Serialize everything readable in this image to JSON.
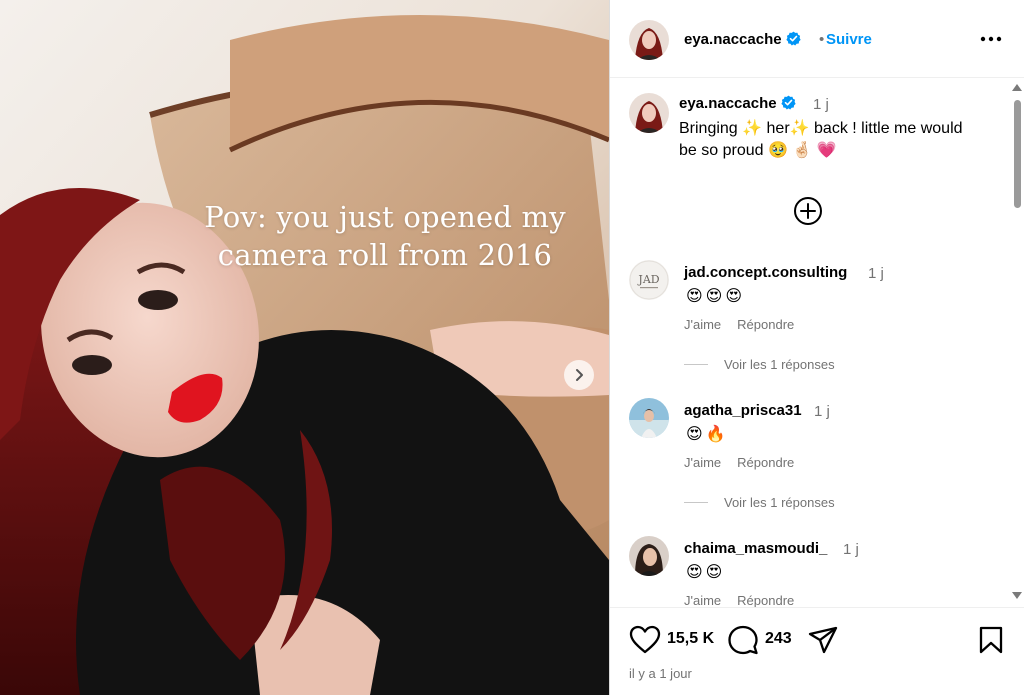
{
  "media": {
    "overlay_line1": "Pov: you just opened my",
    "overlay_line2": "camera roll from 2016"
  },
  "header": {
    "username": "eya.naccache",
    "dot": "•",
    "follow_label": "Suivre",
    "verified": true
  },
  "caption": {
    "username": "eya.naccache",
    "time": "1 j",
    "text_parts": [
      "Bringing ",
      "✨",
      " her",
      "✨",
      " back ! little me would be so proud ",
      "🥹",
      " ",
      "🤞🏻",
      " ",
      "💗"
    ]
  },
  "comments": [
    {
      "username": "jad.concept.consulting",
      "time": "1 j",
      "emojis": "😍😍😍",
      "like_label": "J'aime",
      "reply_label": "Répondre",
      "replies_label": "Voir les 1 réponses"
    },
    {
      "username": "agatha_prisca31",
      "time": "1 j",
      "emojis": "😍🔥",
      "like_label": "J'aime",
      "reply_label": "Répondre",
      "replies_label": "Voir les 1 réponses"
    },
    {
      "username": "chaima_masmoudi_",
      "time": "1 j",
      "emojis": "😍😍",
      "like_label": "J'aime",
      "reply_label": "Répondre"
    }
  ],
  "footer": {
    "likes": "15,5 K",
    "comments": "243",
    "time_ago": "il y a 1 jour"
  },
  "colors": {
    "accent": "#0095f6",
    "verified": "#0095f6",
    "muted": "#737373"
  },
  "icons": [
    "verified-icon",
    "more-icon",
    "add-comment-icon",
    "heart-icon",
    "comment-icon",
    "share-icon",
    "bookmark-icon",
    "chevron-right-icon"
  ]
}
